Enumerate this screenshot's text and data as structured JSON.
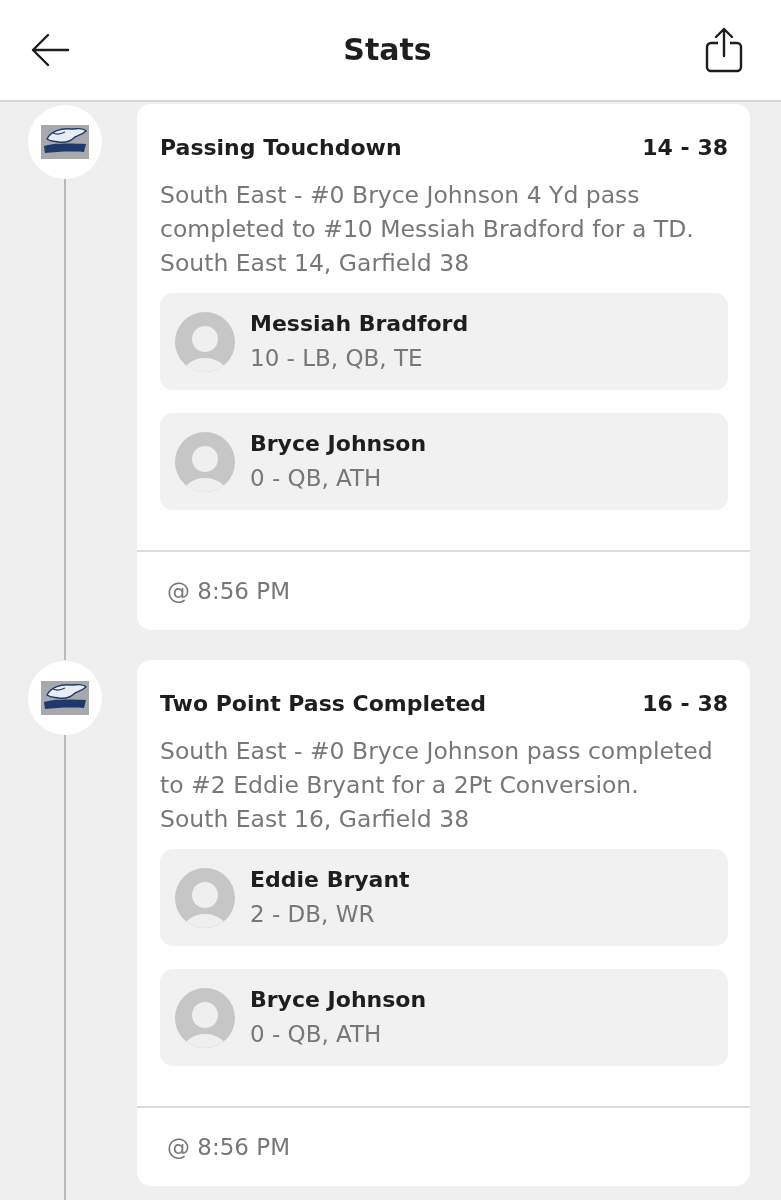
{
  "header": {
    "title": "Stats"
  },
  "events": [
    {
      "title": "Passing Touchdown",
      "score": "14 - 38",
      "description": "South East - #0 Bryce Johnson 4 Yd pass completed to #10 Messiah Bradford for a TD.",
      "summary": "South East 14, Garfield 38",
      "players": [
        {
          "name": "Messiah Bradford",
          "details": "10 - LB, QB, TE"
        },
        {
          "name": "Bryce Johnson",
          "details": "0 - QB, ATH"
        }
      ],
      "time": "@ 8:56 PM"
    },
    {
      "title": "Two Point Pass Completed",
      "score": "16 - 38",
      "description": "South East - #0 Bryce Johnson pass completed to #2 Eddie Bryant for a 2Pt Conversion.",
      "summary": "South East 16, Garfield 38",
      "players": [
        {
          "name": "Eddie Bryant",
          "details": "2 - DB, WR"
        },
        {
          "name": "Bryce Johnson",
          "details": "0 - QB, ATH"
        }
      ],
      "time": "@ 8:56 PM"
    }
  ]
}
